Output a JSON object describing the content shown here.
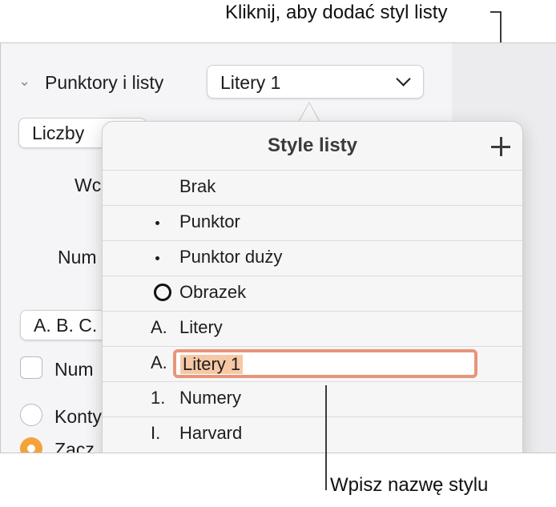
{
  "callouts": {
    "top": "Kliknij, aby dodać styl listy",
    "bottom": "Wpisz nazwę stylu"
  },
  "sidebar": {
    "section_title": "Punktory i listy",
    "list_style_popup": "Litery 1",
    "numbers_popup": "Liczby",
    "label_indent_partial": "Wc",
    "label_number_partial": "Num",
    "format_popup": "A. B. C.",
    "checkbox_label": "Num",
    "radio_continue_label": "Konty",
    "radio_start_label": "Zacz"
  },
  "popover": {
    "title": "Style listy",
    "add_icon": "plus-icon",
    "rows": [
      {
        "marker": "",
        "label": "Brak"
      },
      {
        "marker": "bullet",
        "label": "Punktor"
      },
      {
        "marker": "bullet",
        "label": "Punktor duży"
      },
      {
        "marker": "circle-image",
        "label": "Obrazek"
      },
      {
        "marker": "A.",
        "label": "Litery"
      },
      {
        "marker": "A.",
        "label": "Litery 1",
        "editing": true
      },
      {
        "marker": "1.",
        "label": "Numery"
      },
      {
        "marker": "I.",
        "label": "Harvard"
      }
    ]
  },
  "colors": {
    "accent_orange": "#f3a33a",
    "edit_border": "#e7957a",
    "selection": "#f7c8a6"
  }
}
